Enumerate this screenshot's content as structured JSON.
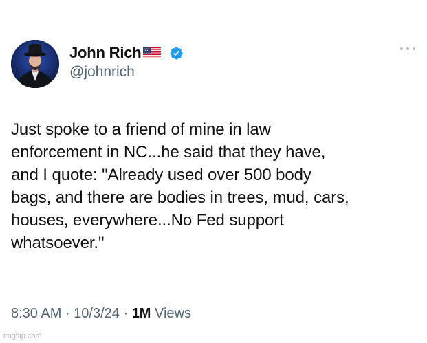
{
  "author": {
    "display_name": "John Rich",
    "handle": "@johnrich",
    "verified": true,
    "flag": "us-flag-emoji"
  },
  "tweet": {
    "text": "Just spoke to a friend of mine in law\nenforcement in NC...he said that they have,\nand I quote: \"Already used over 500 body\nbags, and there are bodies in trees, mud, cars,\nhouses, everywhere...No Fed support\nwhatsoever.\""
  },
  "meta": {
    "time": "8:30 AM",
    "sep1": " · ",
    "date": "10/3/24",
    "sep2": " · ",
    "views_count": "1M",
    "views_label": " Views"
  },
  "icons": {
    "more": "more-horizontal-icon",
    "verified": "verified-badge-icon"
  },
  "colors": {
    "verified_blue": "#1d9bf0",
    "secondary_text": "#536471",
    "primary_text": "#111111"
  },
  "watermark": "imgflip.com"
}
